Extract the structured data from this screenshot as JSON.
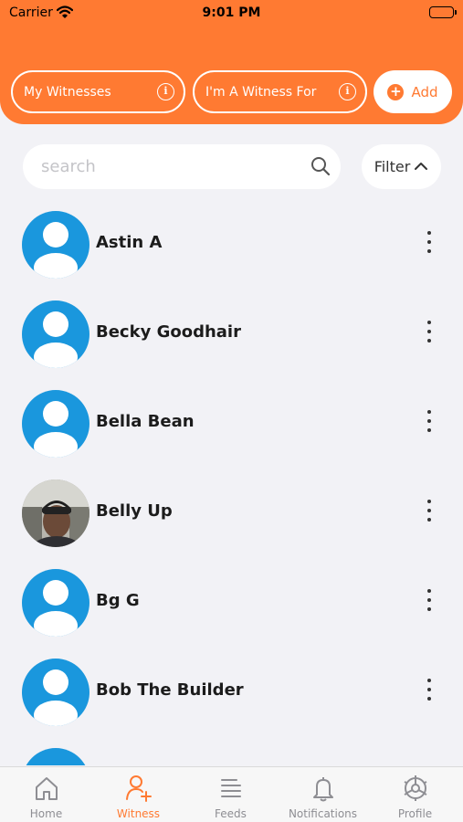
{
  "status_bar": {
    "carrier": "Carrier",
    "time": "9:01 PM"
  },
  "header": {
    "segments": [
      {
        "label": "My Witnesses",
        "info": "i"
      },
      {
        "label": "I'm A Witness For",
        "info": "i"
      }
    ],
    "add_label": "Add",
    "accent_color": "#ff7a32"
  },
  "search": {
    "placeholder": "search",
    "value": ""
  },
  "filter": {
    "label": "Filter"
  },
  "contacts": [
    {
      "name": "Astin A",
      "avatar": "default-user-icon"
    },
    {
      "name": "Becky Goodhair",
      "avatar": "default-user-icon"
    },
    {
      "name": "Bella Bean",
      "avatar": "default-user-icon"
    },
    {
      "name": "Belly Up",
      "avatar": "photo"
    },
    {
      "name": "Bg G",
      "avatar": "default-user-icon"
    },
    {
      "name": "Bob The Builder",
      "avatar": "default-user-icon"
    }
  ],
  "tabs": [
    {
      "label": "Home",
      "icon": "home-icon",
      "active": false
    },
    {
      "label": "Witness",
      "icon": "add-user-icon",
      "active": true
    },
    {
      "label": "Feeds",
      "icon": "feeds-icon",
      "active": false
    },
    {
      "label": "Notifications",
      "icon": "bell-icon",
      "active": false
    },
    {
      "label": "Profile",
      "icon": "profile-gear-icon",
      "active": false
    }
  ]
}
